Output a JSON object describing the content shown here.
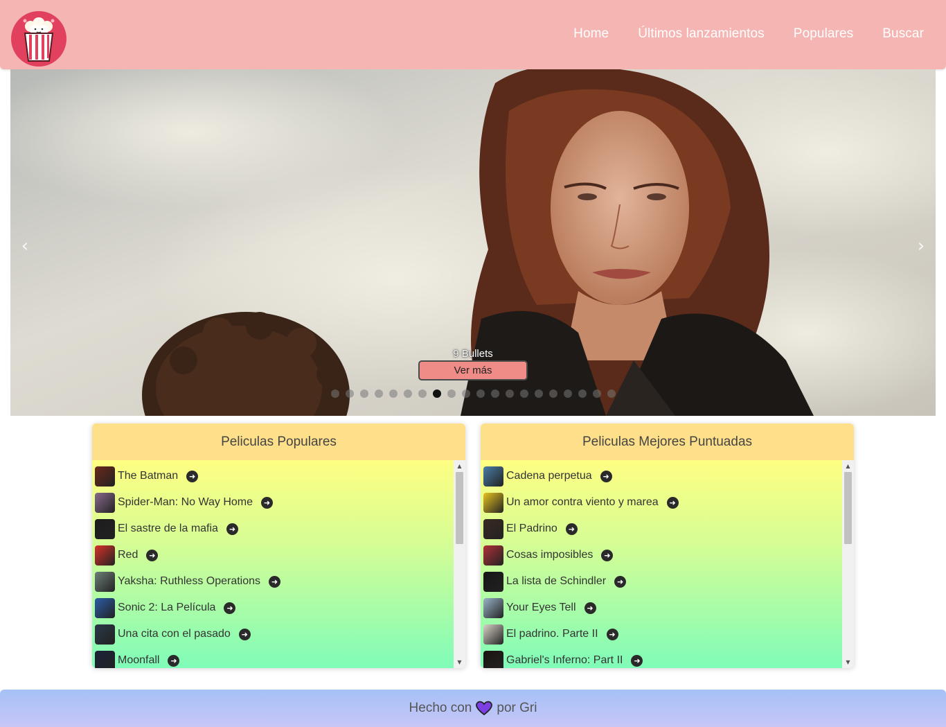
{
  "nav": {
    "logo": "popcorn-logo",
    "links": [
      {
        "label": "Home"
      },
      {
        "label": "Últimos lanzamientos"
      },
      {
        "label": "Populares"
      },
      {
        "label": "Buscar"
      }
    ]
  },
  "carousel": {
    "slide_title": "9 Bullets",
    "cta_label": "Ver más",
    "prev_icon": "chevron-left-icon",
    "next_icon": "chevron-right-icon",
    "bullet_count": 20,
    "active_bullet": 7
  },
  "popular": {
    "title": "Peliculas Populares",
    "items": [
      {
        "label": "The Batman",
        "thumb_color": "#6b2a1a"
      },
      {
        "label": "Spider-Man: No Way Home",
        "thumb_color": "#8a6a8e"
      },
      {
        "label": "El sastre de la mafia",
        "thumb_color": "#1c1c1c"
      },
      {
        "label": "Red",
        "thumb_color": "#d8322a"
      },
      {
        "label": "Yaksha: Ruthless Operations",
        "thumb_color": "#6e7f78"
      },
      {
        "label": "Sonic 2: La Película",
        "thumb_color": "#2b5ca8"
      },
      {
        "label": "Una cita con el pasado",
        "thumb_color": "#2a3848"
      },
      {
        "label": "Moonfall",
        "thumb_color": "#1a2238"
      }
    ]
  },
  "top_rated": {
    "title": "Peliculas Mejores Puntuadas",
    "items": [
      {
        "label": "Cadena perpetua",
        "thumb_color": "#4a7ea8"
      },
      {
        "label": "Un amor contra viento y marea",
        "thumb_color": "#e8c420"
      },
      {
        "label": "El Padrino",
        "thumb_color": "#3a2a22"
      },
      {
        "label": "Cosas imposibles",
        "thumb_color": "#b03038"
      },
      {
        "label": "La lista de Schindler",
        "thumb_color": "#151515"
      },
      {
        "label": "Your Eyes Tell",
        "thumb_color": "#9ab4c8"
      },
      {
        "label": "El padrino. Parte II",
        "thumb_color": "#d8d2c8"
      },
      {
        "label": "Gabriel's Inferno: Part II",
        "thumb_color": "#1a1410"
      }
    ]
  },
  "footer": {
    "prefix": "Hecho con",
    "suffix": "por Gri",
    "icon": "heart-icon",
    "icon_color": "#7b3fe4"
  }
}
